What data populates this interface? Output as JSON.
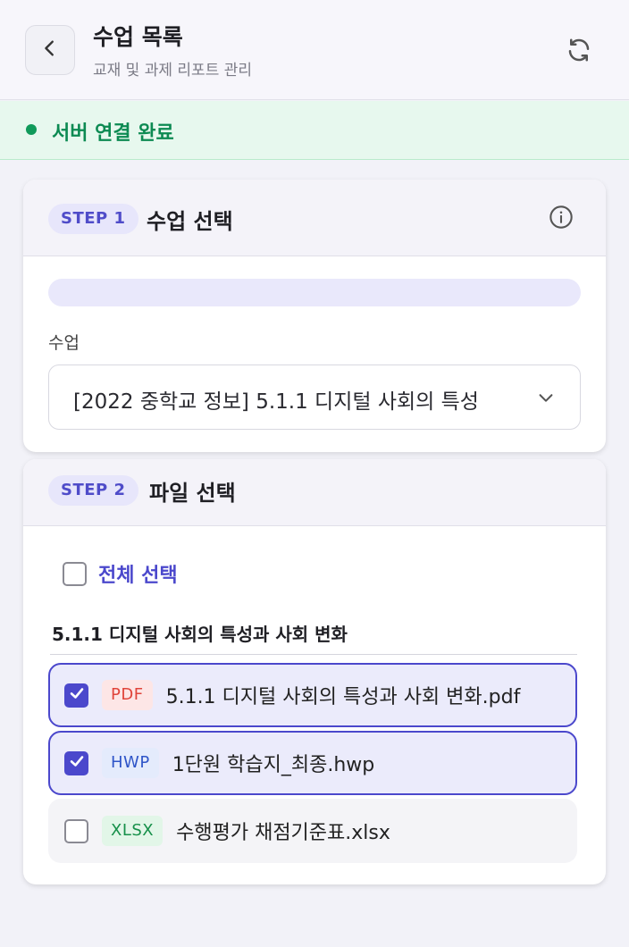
{
  "header": {
    "title": "수업 목록",
    "subtitle": "교재 및 과제 리포트 관리"
  },
  "status": {
    "text": "서버 연결 완료",
    "color": "#109a5a"
  },
  "step1": {
    "badge": "STEP 1",
    "title": "수업 선택",
    "field_label": "수업",
    "selected_lesson": "[2022 중학교 정보] 5.1.1 디지털 사회의 특성"
  },
  "step2": {
    "badge": "STEP 2",
    "title": "파일 선택",
    "select_all_label": "전체 선택",
    "select_all_checked": false,
    "group_title": "5.1.1 디지털 사회의 특성과 사회 변화",
    "files": [
      {
        "type": "PDF",
        "name": "5.1.1 디지털 사회의 특성과 사회 변화.pdf",
        "checked": true
      },
      {
        "type": "HWP",
        "name": "1단원 학습지_최종.hwp",
        "checked": true
      },
      {
        "type": "XLSX",
        "name": "수행평가 채점기준표.xlsx",
        "checked": false
      }
    ]
  },
  "colors": {
    "accent": "#4b48cc",
    "pdf": "#e0443a",
    "hwp": "#2f55c8",
    "xlsx": "#17904a"
  }
}
